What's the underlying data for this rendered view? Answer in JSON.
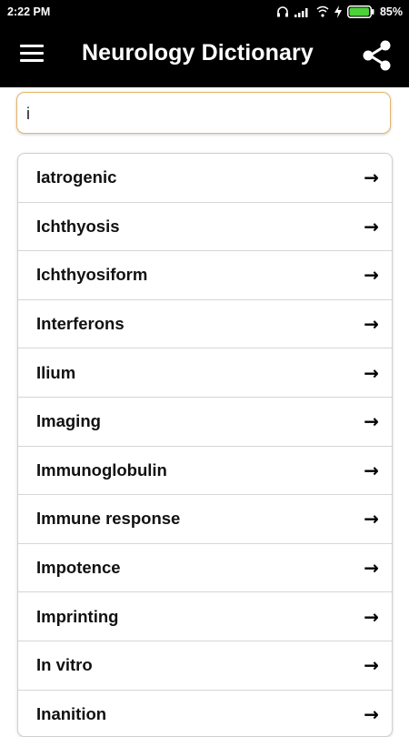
{
  "status_bar": {
    "time": "2:22 PM",
    "battery_percent": "85%",
    "icons": [
      "headphones-icon",
      "signal-icon",
      "wifi-icon",
      "charging-icon",
      "battery-icon"
    ]
  },
  "app_bar": {
    "title": "Neurology Dictionary",
    "menu_icon": "hamburger-menu-icon",
    "share_icon": "share-icon"
  },
  "search": {
    "value": "i",
    "placeholder": ""
  },
  "terms": [
    {
      "label": "Iatrogenic",
      "arrow": "→"
    },
    {
      "label": "Ichthyosis",
      "arrow": "→"
    },
    {
      "label": "Ichthyosiform",
      "arrow": "→"
    },
    {
      "label": "Interferons",
      "arrow": "→"
    },
    {
      "label": "Ilium",
      "arrow": "→"
    },
    {
      "label": "Imaging",
      "arrow": "→"
    },
    {
      "label": "Immunoglobulin",
      "arrow": "→"
    },
    {
      "label": "Immune response",
      "arrow": "→"
    },
    {
      "label": "Impotence",
      "arrow": "→"
    },
    {
      "label": "Imprinting",
      "arrow": "→"
    },
    {
      "label": "In vitro",
      "arrow": "→"
    },
    {
      "label": "Inanition",
      "arrow": "→"
    }
  ],
  "colors": {
    "app_bar": "#000000",
    "search_border": "#e7b46b",
    "battery": "#4cd137"
  }
}
